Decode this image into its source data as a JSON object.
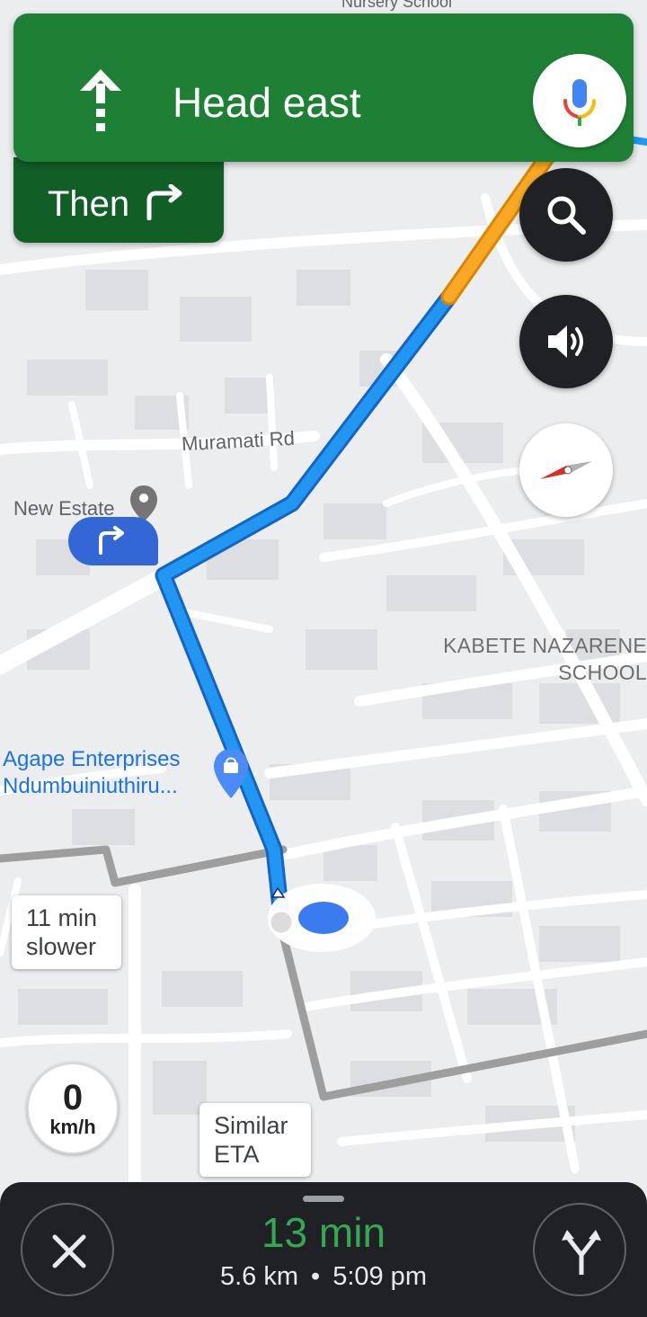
{
  "banner": {
    "instruction": "Head east",
    "then_label": "Then",
    "direction_icon": "arrow-up-icon",
    "then_icon": "turn-right-icon",
    "mic_icon": "google-mic-icon",
    "color": "#1e8035"
  },
  "map": {
    "labels": {
      "nursery": "Nursery School",
      "road": "Muramati Rd",
      "estate": "New Estate",
      "school_line1": "KABETE NAZARENE",
      "school_line2": "SCHOOL",
      "poi_line1": "Agape Enterprises",
      "poi_line2": "Ndumbuiniuthiru..."
    },
    "alternatives": [
      {
        "line1": "11 min",
        "line2": "slower"
      },
      {
        "line1": "Similar",
        "line2": "ETA"
      }
    ],
    "route_color": "#1a73e8",
    "traffic_color": "#f29900"
  },
  "controls": {
    "search_icon": "search-icon",
    "sound_icon": "volume-icon",
    "compass_icon": "compass-icon"
  },
  "speed": {
    "value": "0",
    "unit": "km/h"
  },
  "trip": {
    "duration": "13 min",
    "distance": "5.6 km",
    "separator": "•",
    "arrival": "5:09 pm",
    "close_icon": "close-icon",
    "routes_icon": "alt-routes-icon"
  }
}
